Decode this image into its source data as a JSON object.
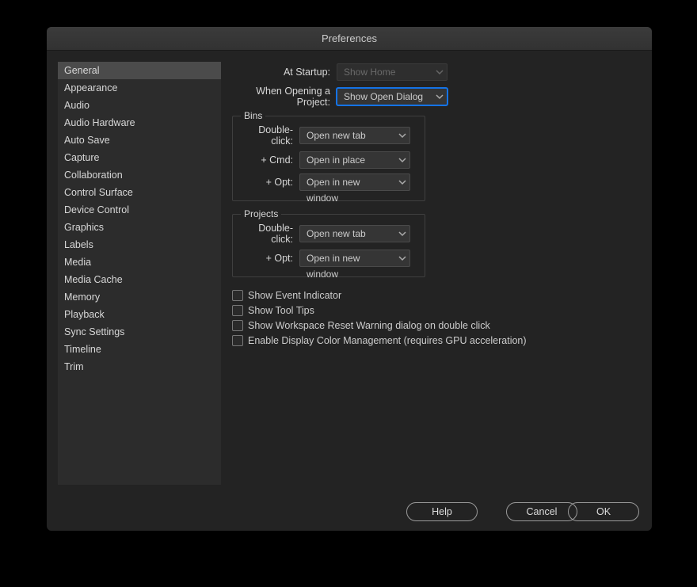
{
  "title": "Preferences",
  "sidebar": {
    "items": [
      {
        "label": "General",
        "selected": true
      },
      {
        "label": "Appearance"
      },
      {
        "label": "Audio"
      },
      {
        "label": "Audio Hardware"
      },
      {
        "label": "Auto Save"
      },
      {
        "label": "Capture"
      },
      {
        "label": "Collaboration"
      },
      {
        "label": "Control Surface"
      },
      {
        "label": "Device Control"
      },
      {
        "label": "Graphics"
      },
      {
        "label": "Labels"
      },
      {
        "label": "Media"
      },
      {
        "label": "Media Cache"
      },
      {
        "label": "Memory"
      },
      {
        "label": "Playback"
      },
      {
        "label": "Sync Settings"
      },
      {
        "label": "Timeline"
      },
      {
        "label": "Trim"
      }
    ]
  },
  "main": {
    "at_startup": {
      "label": "At Startup:",
      "value": "Show Home",
      "disabled": true
    },
    "when_opening": {
      "label": "When Opening a Project:",
      "value": "Show Open Dialog",
      "highlight": true
    },
    "groups": {
      "bins": {
        "title": "Bins",
        "rows": [
          {
            "label": "Double-click:",
            "value": "Open new tab"
          },
          {
            "label": "+ Cmd:",
            "value": "Open in place"
          },
          {
            "label": "+ Opt:",
            "value": "Open in new window"
          }
        ]
      },
      "projects": {
        "title": "Projects",
        "rows": [
          {
            "label": "Double-click:",
            "value": "Open new tab"
          },
          {
            "label": "+ Opt:",
            "value": "Open in new window"
          }
        ]
      }
    },
    "checkboxes": [
      {
        "label": "Show Event Indicator",
        "checked": false
      },
      {
        "label": "Show Tool Tips",
        "checked": false
      },
      {
        "label": "Show Workspace Reset Warning dialog on double click",
        "checked": false
      },
      {
        "label": "Enable Display Color Management (requires GPU acceleration)",
        "checked": false
      }
    ]
  },
  "footer": {
    "help": "Help",
    "cancel": "Cancel",
    "ok": "OK"
  }
}
